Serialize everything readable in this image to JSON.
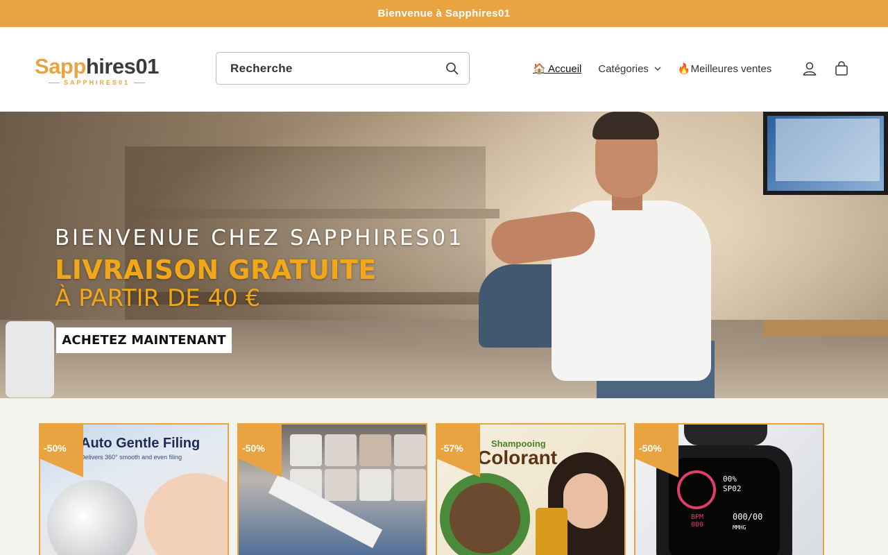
{
  "announcement": {
    "text": "Bienvenue à Sapphires01"
  },
  "header": {
    "logo": {
      "main_s": "S",
      "main_app": "app",
      "main_rest": "hires01",
      "sub": "SAPPHIRES01"
    },
    "search": {
      "placeholder": "Recherche",
      "icon": "search-icon"
    },
    "nav": [
      {
        "label": "🏠 Accueil",
        "active": true
      },
      {
        "label": "Catégories",
        "has_dropdown": true
      },
      {
        "label": "🔥Meilleures ventes"
      }
    ],
    "icons": [
      "account-icon",
      "cart-icon"
    ]
  },
  "hero": {
    "line1": "BIENVENUE CHEZ SAPPHIRES01",
    "line2": "LIVRAISON GRATUITE",
    "line3": "À PARTIR DE 40 €",
    "cta": "ACHETEZ MAINTENANT"
  },
  "products": [
    {
      "badge": "-50%",
      "title": "Auto Gentle Filing",
      "subtitle": "Delivers 360° smooth and even filing"
    },
    {
      "badge": "-50%"
    },
    {
      "badge": "-57%",
      "tag": "Shampooing",
      "title": "Colorant"
    },
    {
      "badge": "-50%",
      "screen_a": "00%",
      "screen_b": "SP02",
      "screen_c": "BPM",
      "screen_d": "000",
      "screen_e": "000/00",
      "screen_f": "MMHG"
    }
  ],
  "colors": {
    "accent": "#e9a441",
    "hero_highlight": "#f2a719",
    "product_bg": "#f4f4ef"
  }
}
